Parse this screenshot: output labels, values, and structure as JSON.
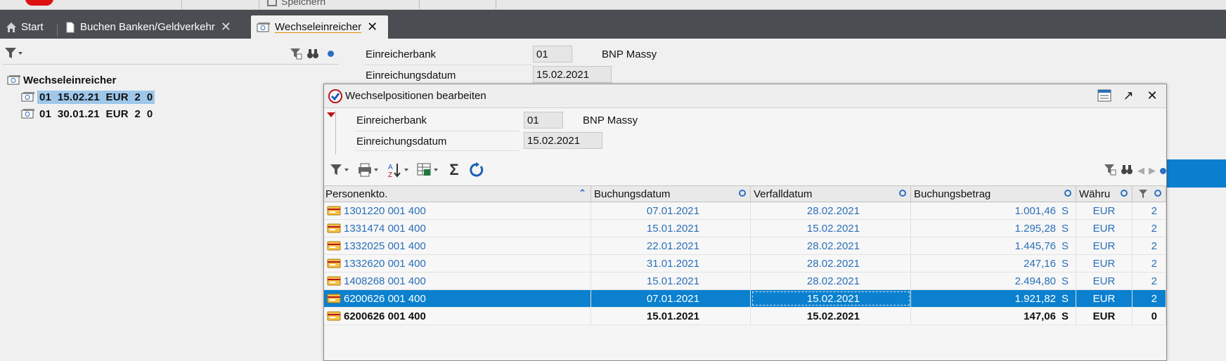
{
  "top": {
    "save_label": "Speichern"
  },
  "tabs": [
    {
      "label": "Start"
    },
    {
      "label": "Buchen Banken/Geldverkehr"
    },
    {
      "label": "Wechseleinreicher"
    }
  ],
  "tree": {
    "root": "Wechseleinreicher",
    "items": [
      {
        "label": "01  15.02.21  EUR  2  0",
        "selected": true
      },
      {
        "label": "01  30.01.21  EUR  2  0",
        "selected": false
      }
    ]
  },
  "header_form": {
    "bank_label": "Einreicherbank",
    "bank_value": "01",
    "bank_name": "BNP Massy",
    "date_label": "Einreichungsdatum",
    "date_value": "15.02.2021"
  },
  "dialog": {
    "title": "Wechselpositionen bearbeiten",
    "bank_label": "Einreicherbank",
    "bank_value": "01",
    "bank_name": "BNP Massy",
    "date_label": "Einreichungsdatum",
    "date_value": "15.02.2021",
    "columns": [
      "Personenkto.",
      "Buchungsdatum",
      "Verfalldatum",
      "Buchungsbetrag",
      "Währu",
      ""
    ],
    "rows": [
      {
        "konto": "1301220 001 400",
        "buchung": "07.01.2021",
        "verfall": "28.02.2021",
        "betrag": "1.001,46",
        "sh": "S",
        "waehrung": "EUR",
        "n": "2",
        "state": "normal"
      },
      {
        "konto": "1331474 001 400",
        "buchung": "15.01.2021",
        "verfall": "15.02.2021",
        "betrag": "1.295,28",
        "sh": "S",
        "waehrung": "EUR",
        "n": "2",
        "state": "normal"
      },
      {
        "konto": "1332025 001 400",
        "buchung": "22.01.2021",
        "verfall": "28.02.2021",
        "betrag": "1.445,76",
        "sh": "S",
        "waehrung": "EUR",
        "n": "2",
        "state": "normal"
      },
      {
        "konto": "1332620 001 400",
        "buchung": "31.01.2021",
        "verfall": "28.02.2021",
        "betrag": "247,16",
        "sh": "S",
        "waehrung": "EUR",
        "n": "2",
        "state": "normal"
      },
      {
        "konto": "1408268 001 400",
        "buchung": "15.01.2021",
        "verfall": "28.02.2021",
        "betrag": "2.494,80",
        "sh": "S",
        "waehrung": "EUR",
        "n": "2",
        "state": "normal"
      },
      {
        "konto": "6200626 001 400",
        "buchung": "07.01.2021",
        "verfall": "15.02.2021",
        "betrag": "1.921,82",
        "sh": "S",
        "waehrung": "EUR",
        "n": "2",
        "state": "selected"
      },
      {
        "konto": "6200626 001 400",
        "buchung": "15.01.2021",
        "verfall": "15.02.2021",
        "betrag": "147,06",
        "sh": "S",
        "waehrung": "EUR",
        "n": "0",
        "state": "bold"
      }
    ]
  },
  "colors": {
    "accent": "#0a80cf",
    "tabbar": "#4a4d52",
    "link_text": "#2a6fb8",
    "tree_selection": "#9ec7ea"
  }
}
